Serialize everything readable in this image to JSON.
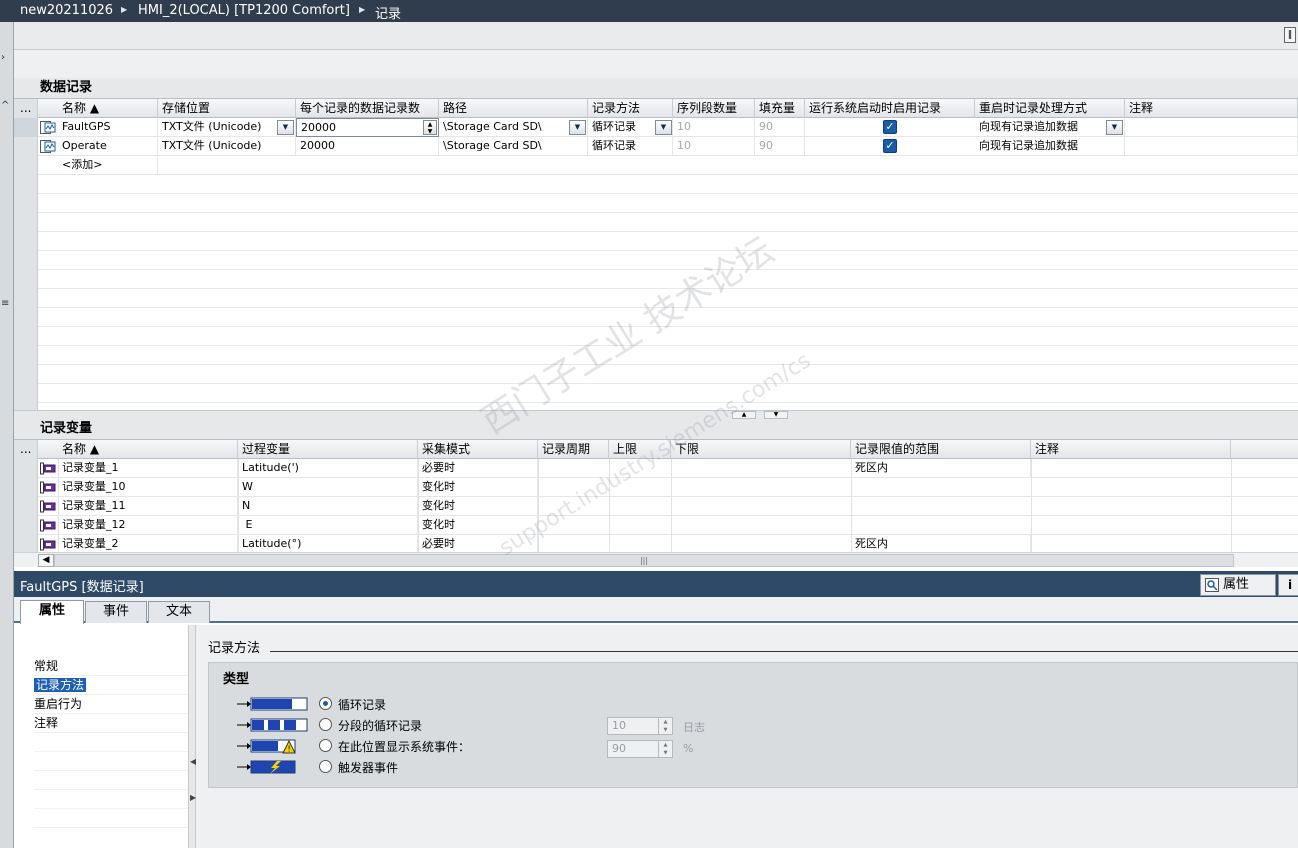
{
  "breadcrumb": [
    "new20211026",
    "HMI_2(LOCAL) [TP1200 Comfort]",
    "记录"
  ],
  "toolbar": {
    "right_button": "‖"
  },
  "data_logs": {
    "title": "数据记录",
    "headers": [
      "...",
      "名称 ▲",
      "存储位置",
      "每个记录的数据记录数",
      "路径",
      "记录方法",
      "序列段数量",
      "填充量",
      "运行系统启动时启用记录",
      "重启时记录处理方式",
      "注释"
    ],
    "rows": [
      {
        "name": "FaultGPS",
        "storage": "TXT文件 (Unicode)",
        "records": "20000",
        "path": "\\Storage Card SD\\",
        "method": "循环记录",
        "segments": "10",
        "fill": "90",
        "enabled": true,
        "restart": "向现有记录追加数据",
        "comment": ""
      },
      {
        "name": "Operate",
        "storage": "TXT文件 (Unicode)",
        "records": "20000",
        "path": "\\Storage Card SD\\",
        "method": "循环记录",
        "segments": "10",
        "fill": "90",
        "enabled": true,
        "restart": "向现有记录追加数据",
        "comment": ""
      }
    ],
    "add_label": "<添加>"
  },
  "log_tags": {
    "title": "记录变量",
    "headers": [
      "...",
      "名称 ▲",
      "过程变量",
      "采集模式",
      "记录周期",
      "上限",
      "下限",
      "记录限值的范围",
      "注释"
    ],
    "rows": [
      {
        "name": "记录变量_1",
        "process": "Latitude(')",
        "mode": "必要时",
        "cycle": "",
        "upper": "",
        "lower": "",
        "range": "死区内",
        "comment": ""
      },
      {
        "name": "记录变量_10",
        "process": "W",
        "mode": "变化时",
        "cycle": "",
        "upper": "",
        "lower": "",
        "range": "",
        "comment": ""
      },
      {
        "name": "记录变量_11",
        "process": "N",
        "mode": "变化时",
        "cycle": "",
        "upper": "",
        "lower": "",
        "range": "",
        "comment": ""
      },
      {
        "name": "记录变量_12",
        "process": " E",
        "mode": "变化时",
        "cycle": "",
        "upper": "",
        "lower": "",
        "range": "",
        "comment": ""
      },
      {
        "name": "记录变量_2",
        "process": "Latitude(°)",
        "mode": "必要时",
        "cycle": "",
        "upper": "",
        "lower": "",
        "range": "死区内",
        "comment": ""
      }
    ]
  },
  "properties": {
    "title": "FaultGPS [数据记录]",
    "right_tab": "属性",
    "info_tab": "i",
    "tabs": [
      "属性",
      "事件",
      "文本"
    ],
    "nav": [
      "常规",
      "记录方法",
      "重启行为",
      "注释"
    ],
    "section": "记录方法",
    "group_title": "类型",
    "options": [
      "循环记录",
      "分段的循环记录",
      "在此位置显示系统事件：",
      "触发器事件"
    ],
    "segments_value": "10",
    "segments_unit": "日志",
    "percent_value": "90",
    "percent_unit": "%"
  },
  "watermark": {
    "line1": "西门子工业 技术论坛",
    "line2": "support.industry.siemens.com/cs"
  },
  "colors": {
    "titlebar": "#2f3d4c",
    "propbar": "#2f4a66",
    "selection": "#1f5fb3",
    "checkbox": "#1a5ca8"
  }
}
